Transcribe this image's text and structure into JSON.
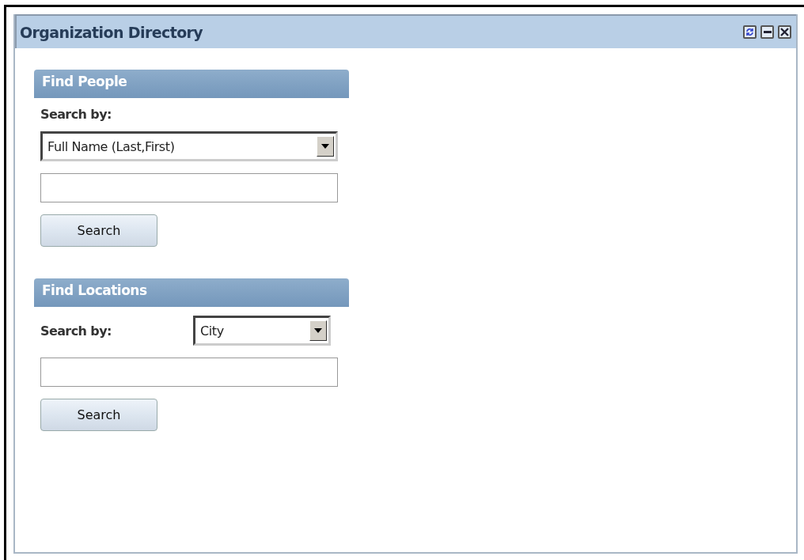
{
  "portlet": {
    "title": "Organization Directory"
  },
  "sections": [
    {
      "heading": "Find People",
      "kind": "stacked",
      "search_by_label": "Search by:",
      "select_value": "Full Name (Last,First)",
      "button": "Search"
    },
    {
      "heading": "Find Locations",
      "kind": "inline",
      "search_by_label": "Search by:",
      "select_value": "City",
      "button": "Search"
    }
  ]
}
